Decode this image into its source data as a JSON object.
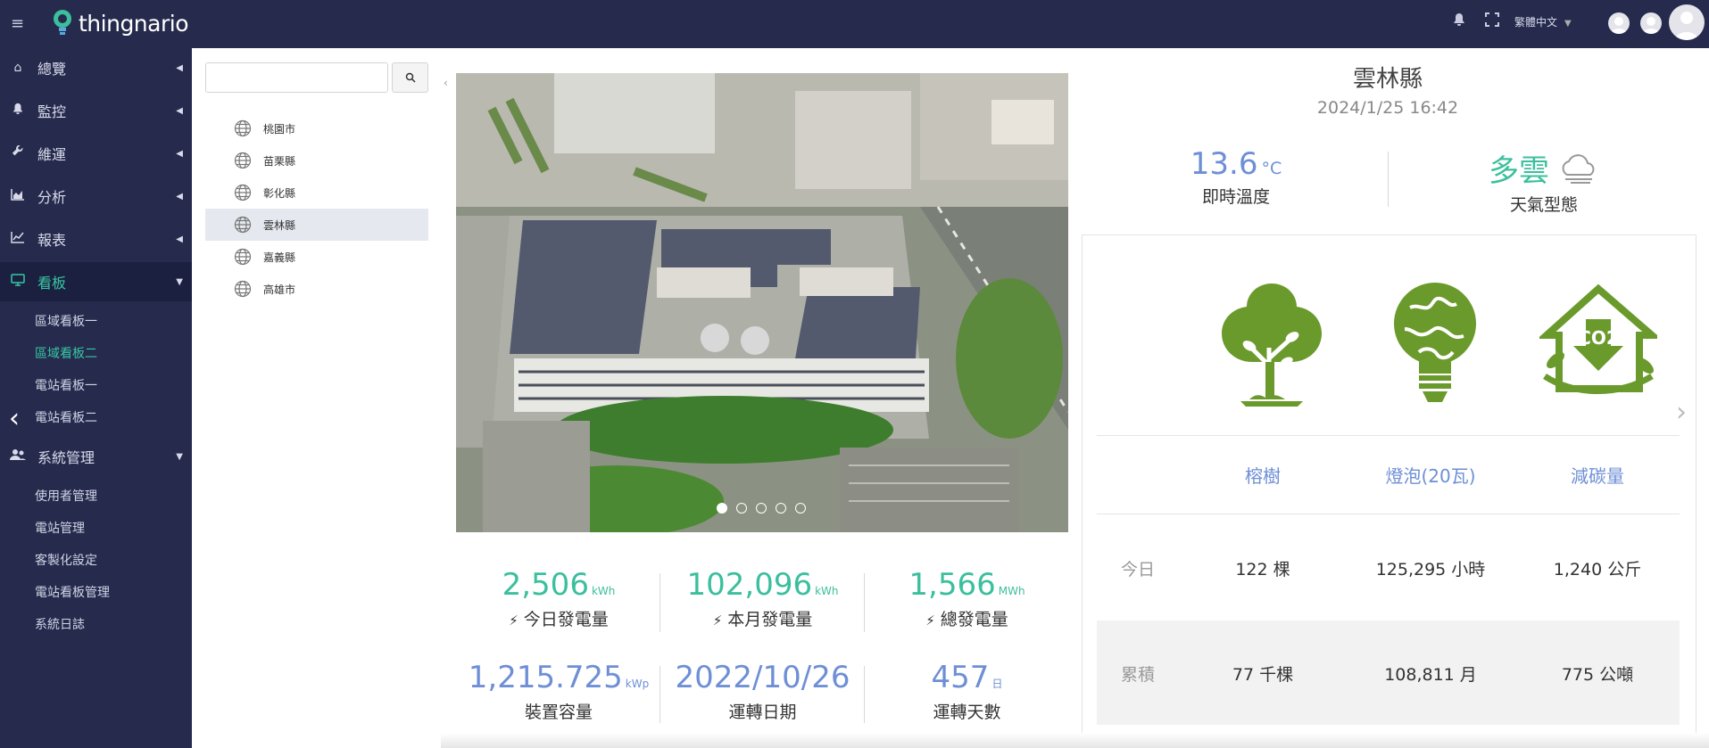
{
  "brand": {
    "name": "thingnario"
  },
  "header": {
    "language": "繁體中文"
  },
  "sidebar": {
    "items": [
      {
        "label": "總覽"
      },
      {
        "label": "監控"
      },
      {
        "label": "維運"
      },
      {
        "label": "分析"
      },
      {
        "label": "報表"
      },
      {
        "label": "看板"
      },
      {
        "label": "系統管理"
      }
    ],
    "dashboard_sub": [
      "區域看板一",
      "區域看板二",
      "電站看板一",
      "電站看板二"
    ],
    "admin_sub": [
      "使用者管理",
      "電站管理",
      "客製化設定",
      "電站看板管理",
      "系統日誌"
    ]
  },
  "tree": {
    "search_value": "",
    "items": [
      "桃園市",
      "苗栗縣",
      "彰化縣",
      "雲林縣",
      "嘉義縣",
      "高雄市"
    ],
    "selected": "雲林縣"
  },
  "carousel": {
    "slides": 5,
    "active": 1
  },
  "stats": {
    "today": {
      "value": "2,506",
      "unit": "kWh",
      "label": "今日發電量"
    },
    "month": {
      "value": "102,096",
      "unit": "kWh",
      "label": "本月發電量"
    },
    "total": {
      "value": "1,566",
      "unit": "MWh",
      "label": "總發電量"
    },
    "capacity": {
      "value": "1,215.725",
      "unit": "kWp",
      "label": "裝置容量"
    },
    "start_date": {
      "value": "2022/10/26",
      "label": "運轉日期"
    },
    "days": {
      "value": "457",
      "unit": "日",
      "label": "運轉天數"
    }
  },
  "location": {
    "name": "雲林縣",
    "datetime": "2024/1/25 16:42",
    "temperature": {
      "value": "13.6",
      "unit": "°C",
      "label": "即時溫度"
    },
    "weather": {
      "value": "多雲",
      "label": "天氣型態"
    }
  },
  "environment": {
    "headers": [
      "榕樹",
      "燈泡(20瓦)",
      "減碳量"
    ],
    "rows": [
      {
        "label": "今日",
        "values": [
          "122 棵",
          "125,295 小時",
          "1,240 公斤"
        ]
      },
      {
        "label": "累積",
        "values": [
          "77 千棵",
          "108,811 月",
          "775 公噸"
        ]
      }
    ]
  },
  "colors": {
    "topbar": "#262b4d",
    "accent_green": "#3bbf9d",
    "accent_blue": "#6e8fd6",
    "icon_green": "#6a9a2c"
  }
}
